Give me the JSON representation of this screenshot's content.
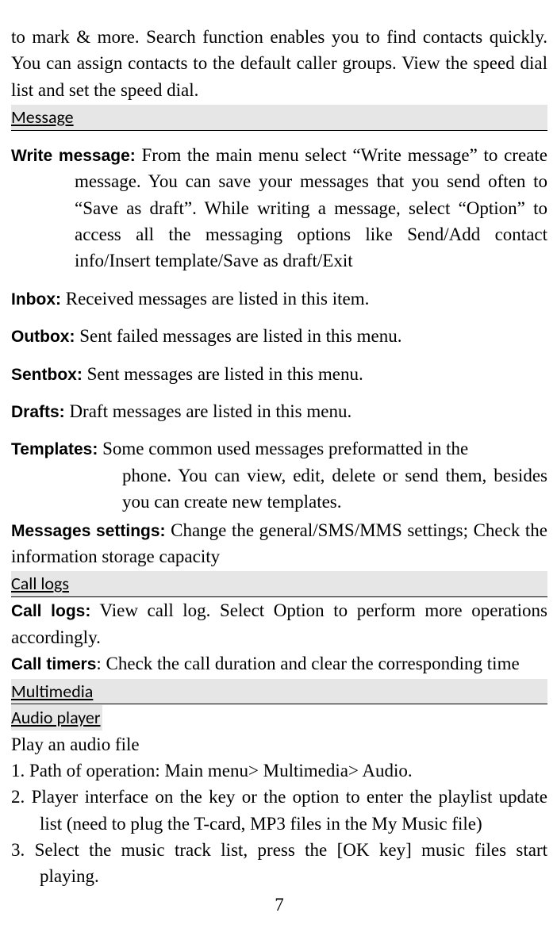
{
  "intro": "to mark & more. Search function enables you to find contacts quickly. You can assign contacts to the default caller groups. View the speed dial list and set the speed dial.",
  "section_message": "Message",
  "write_label": "Write message:",
  "write_body": " From the main menu select “Write message” to create message. You can save your messages that you send often to  “Save as draft”. While writing a message, select “Option” to access all the messaging options like Send/Add contact info/Insert template/Save as draft/Exit",
  "inbox_label": "Inbox:",
  "inbox_body": " Received messages are listed in this item.",
  "outbox_label": "Outbox:",
  "outbox_body": " Sent failed messages are listed in this menu.",
  "sentbox_label": "Sentbox:",
  "sentbox_body": " Sent messages are listed in this menu.",
  "drafts_label": "Drafts:",
  "drafts_body": " Draft messages are listed in this menu.",
  "templates_label": "Templates:",
  "templates_body_first": " Some common used messages preformatted in the",
  "templates_body_rest": "phone. You can view, edit, delete or send them, besides you can create new templates.",
  "msgset_label": "Messages settings:",
  "msgset_body": " Change the general/SMS/MMS settings; Check the information storage capacity",
  "section_calllogs": "Call logs",
  "calllogs_label": "Call logs:",
  "calllogs_body": " View call log. Select Option to perform more operations accordingly.",
  "calltimers_label": "Call timers",
  "calltimers_body": ": Check the call duration and clear the corresponding time",
  "section_multimedia": "Multimedia",
  "sub_audio": "Audio player",
  "audio_line": "Play an audio file",
  "num1": "1. Path of operation: Main menu> Multimedia> Audio.",
  "num2": "2. Player interface on the key or the option to enter the playlist update list (need to plug the T-card, MP3 files in the My Music file)",
  "num3": "3. Select the music track list, press the [OK key] music files start playing.",
  "pagenum": "7"
}
